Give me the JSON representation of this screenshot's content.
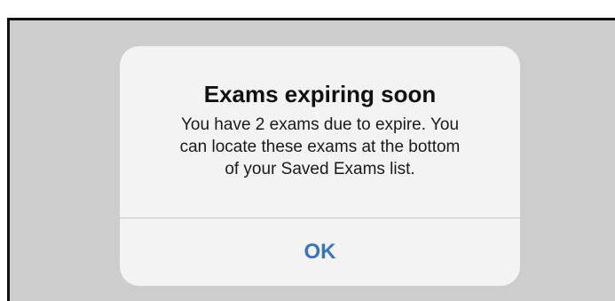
{
  "alert": {
    "title": "Exams expiring soon",
    "message_lines": [
      "You have 2 exams due to expire. You",
      "can locate these exams at the bottom",
      "of your Saved Exams list."
    ],
    "ok_label": "OK"
  },
  "colors": {
    "backdrop": "#cdcdcd",
    "alert_background": "#f3f3f3",
    "button_text": "#3a73be",
    "divider": "#c6c6c8"
  }
}
